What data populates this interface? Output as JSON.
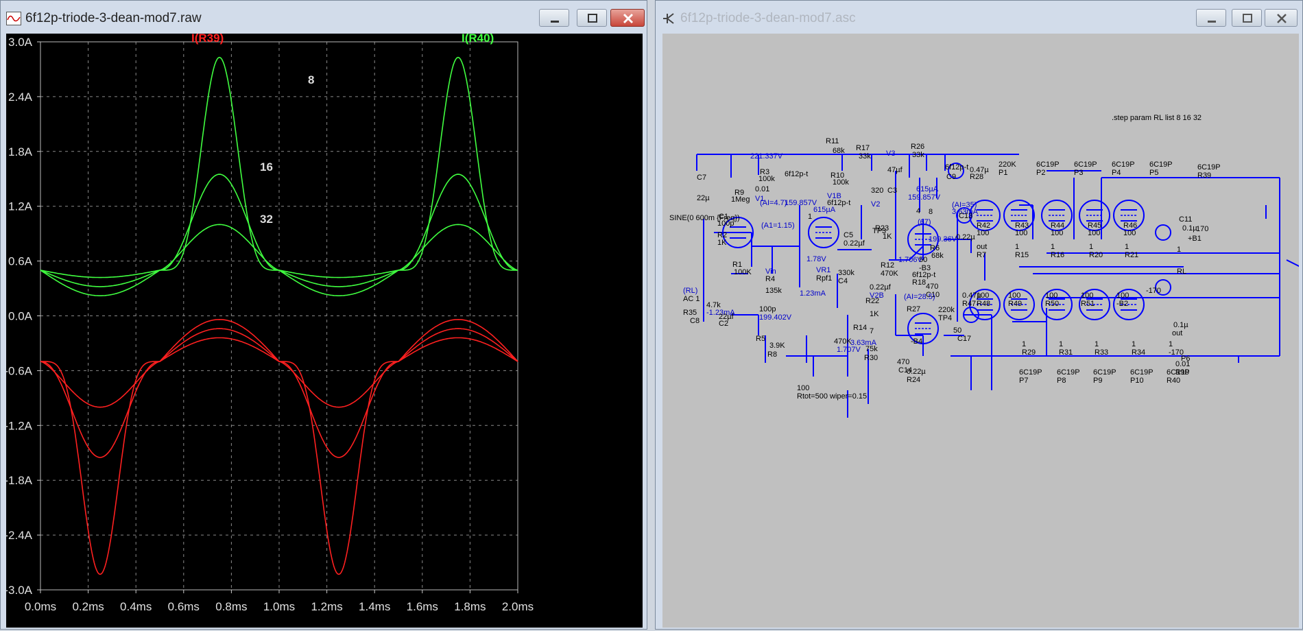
{
  "left_window": {
    "title": "6f12p-triode-3-dean-mod7.raw",
    "traces": [
      "I(R39)",
      "I(R40)"
    ],
    "step_labels": [
      "8",
      "16",
      "32"
    ],
    "y_ticks": [
      "3.0A",
      "2.4A",
      "1.8A",
      "1.2A",
      "0.6A",
      "0.0A",
      "-0.6A",
      "-1.2A",
      "-1.8A",
      "-2.4A",
      "-3.0A"
    ],
    "x_ticks": [
      "0.0ms",
      "0.2ms",
      "0.4ms",
      "0.6ms",
      "0.8ms",
      "1.0ms",
      "1.2ms",
      "1.4ms",
      "1.6ms",
      "1.8ms",
      "2.0ms"
    ],
    "colors": {
      "r39": "#ff2020",
      "r40": "#40ff40",
      "grid": "#8a8a8a",
      "background": "#000000"
    }
  },
  "right_window": {
    "title": "6f12p-triode-3-dean-mod7.asc",
    "directive": ".step param RL list 8 16 32",
    "schematic_color": "#0000ff",
    "labels": [
      "R11",
      "68k",
      "R17",
      "33k",
      "V3",
      "R26",
      "33k",
      "221.337V",
      "C7",
      "22µ",
      "R9",
      "1Meg",
      "R3",
      "100k",
      "R10",
      "100k",
      "V1B",
      "6f12p-t",
      "C3",
      "47µf",
      "320",
      "V2",
      "6f12p-t",
      "C9",
      "0.47µ",
      "R28",
      "220K",
      "P1",
      "6C19P",
      "P2",
      "6C19P",
      "P3",
      "6C19P",
      "P4",
      "6C19P",
      "P5",
      "6C19P",
      "R39",
      "0.01",
      "V1",
      "6f12p-t",
      "615µA",
      "(AI=4.7)",
      "159.857V",
      "1",
      "615µA",
      "159.857V",
      "4",
      "(67)",
      "199.36V",
      "8",
      "(AI=35)",
      "3.63mA",
      "C13",
      "0.22µ",
      "50",
      "-B3",
      "C11",
      "0.1µ",
      "+B1",
      "170",
      "SINE(0 600m {Freq})",
      "C1",
      "100p",
      "R2",
      "1K",
      "(A1=1.15)",
      "C5",
      "0.22µf",
      "TP3",
      "R23",
      "1K",
      "R42",
      "100",
      "R43",
      "100",
      "R44",
      "100",
      "R45",
      "100",
      "R46",
      "100",
      "R1",
      "100K",
      "1.78V",
      "R12",
      "470K",
      "1.706V",
      "R6",
      "68k",
      "out",
      "R7",
      "1",
      "R15",
      "1",
      "R16",
      "1",
      "R20",
      "1",
      "R21",
      "1",
      "RL",
      "(RL)",
      "AC 1",
      "Vin",
      "R4",
      "135k",
      "1.23mA",
      "VR1",
      "Rpf1",
      "330k",
      "C4",
      "0.22µf",
      "V2B",
      "6f12p-t",
      "R18",
      "470",
      "C10",
      "0.47µ",
      "R47",
      "100",
      "R48",
      "100",
      "R49",
      "100",
      "R50",
      "100",
      "R51",
      "100",
      "-B2",
      "-170",
      "R35",
      "4.7k",
      "-1.23mA",
      "C8",
      "22µf",
      "C2",
      "100p",
      "199.402V",
      "R22",
      "1K",
      "7",
      "(AI=28.5)",
      "R27",
      "220k",
      "TP4",
      "R14",
      "470K",
      "1.707V",
      "3.63mA",
      "-B4",
      "50",
      "C17",
      "0.1µ",
      "out",
      "R5",
      "3.9K",
      "R8",
      "75k",
      "R30",
      "470",
      "C14",
      "0.22µ",
      "R24",
      "1",
      "R29",
      "1",
      "R31",
      "1",
      "R33",
      "1",
      "R34",
      "1",
      "-170",
      "P6",
      "6C19P",
      "P7",
      "6C19P",
      "P8",
      "6C19P",
      "P9",
      "6C19P",
      "P10",
      "6C19P",
      "R40",
      "0.01",
      "R19",
      "100",
      "Rtot=500 wiper=0.15"
    ]
  }
}
